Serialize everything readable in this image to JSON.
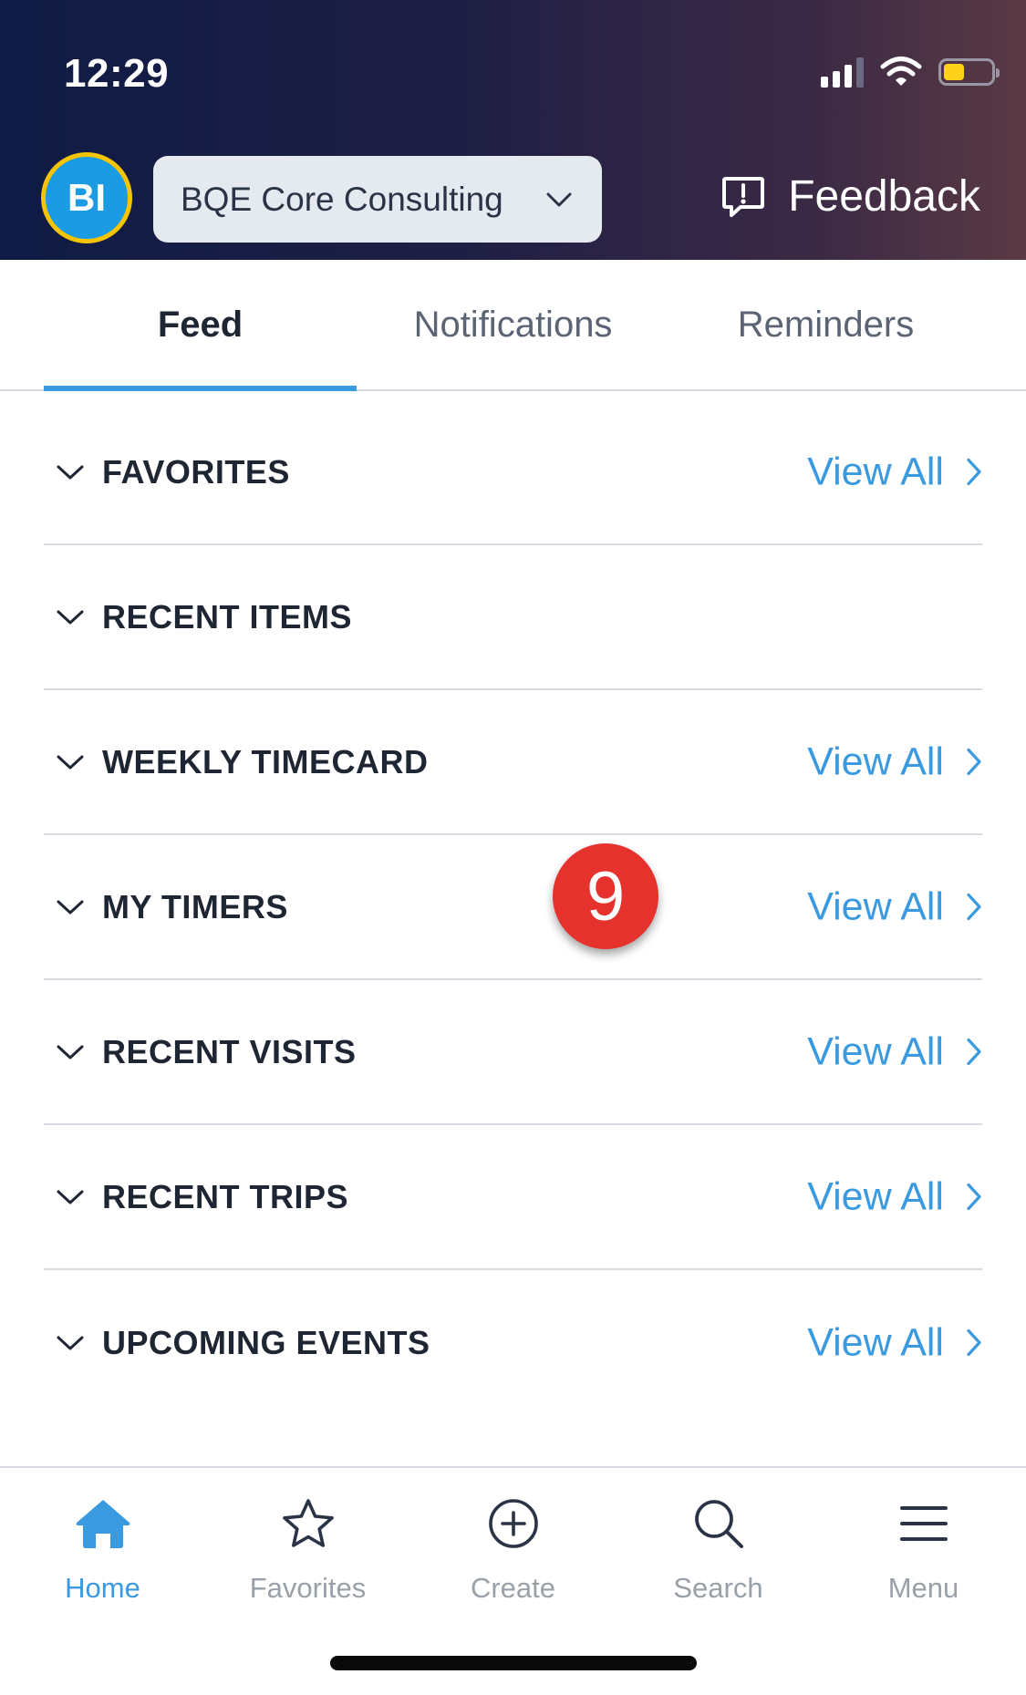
{
  "status_bar": {
    "time": "12:29",
    "icons": [
      "cellular-signal-icon",
      "wifi-icon",
      "battery-icon"
    ]
  },
  "header": {
    "avatar_initials": "BI",
    "company_name": "BQE Core Consulting",
    "feedback_label": "Feedback"
  },
  "tabs": [
    {
      "label": "Feed",
      "active": true
    },
    {
      "label": "Notifications",
      "active": false
    },
    {
      "label": "Reminders",
      "active": false
    }
  ],
  "sections": [
    {
      "title": "FAVORITES",
      "view_all": "View All"
    },
    {
      "title": "RECENT ITEMS",
      "view_all": ""
    },
    {
      "title": "WEEKLY TIMECARD",
      "view_all": "View All"
    },
    {
      "title": "MY TIMERS",
      "view_all": "View All"
    },
    {
      "title": "RECENT VISITS",
      "view_all": "View All"
    },
    {
      "title": "RECENT TRIPS",
      "view_all": "View All"
    },
    {
      "title": "UPCOMING EVENTS",
      "view_all": "View All"
    }
  ],
  "badge": {
    "value": "9"
  },
  "bottom_nav": [
    {
      "label": "Home",
      "icon": "home-icon",
      "active": true
    },
    {
      "label": "Favorites",
      "icon": "star-icon",
      "active": false
    },
    {
      "label": "Create",
      "icon": "plus-circle-icon",
      "active": false
    },
    {
      "label": "Search",
      "icon": "search-icon",
      "active": false
    },
    {
      "label": "Menu",
      "icon": "menu-icon",
      "active": false
    }
  ],
  "colors": {
    "accent": "#3a9ae0",
    "badge": "#e5322d",
    "avatar_bg": "#1b9be3",
    "avatar_ring": "#f6c400"
  }
}
